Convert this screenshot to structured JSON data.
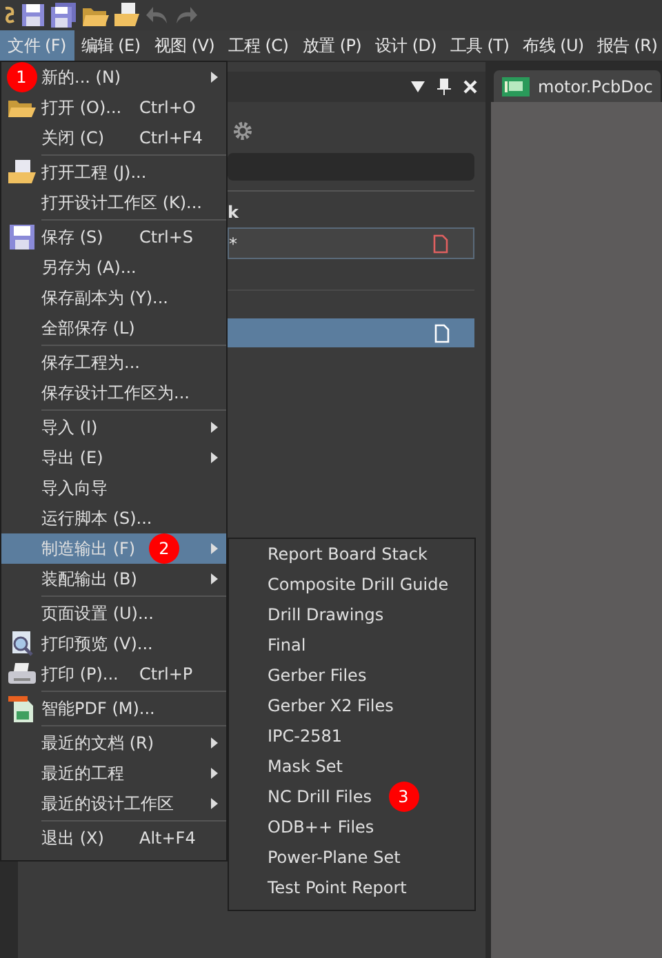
{
  "menubar": [
    {
      "label": "文件 (F)",
      "selected": true
    },
    {
      "label": "编辑 (E)",
      "selected": false
    },
    {
      "label": "视图 (V)",
      "selected": false
    },
    {
      "label": "工程 (C)",
      "selected": false
    },
    {
      "label": "放置 (P)",
      "selected": false
    },
    {
      "label": "设计 (D)",
      "selected": false
    },
    {
      "label": "工具 (T)",
      "selected": false
    },
    {
      "label": "布线 (U)",
      "selected": false
    },
    {
      "label": "报告 (R)",
      "selected": false
    }
  ],
  "document_tab": {
    "label": "motor.PcbDoc"
  },
  "panel": {
    "heading_fragment": "k",
    "row_fragment": "*"
  },
  "file_menu": [
    {
      "kind": "item",
      "label": "新的... (N)",
      "submenu": true,
      "selected": false,
      "badge": {
        "text": "1",
        "kind": "icon-slot"
      }
    },
    {
      "kind": "item",
      "label": "打开 (O)...",
      "shortcut": "Ctrl+O",
      "selected": false
    },
    {
      "kind": "item",
      "label": "关闭 (C)",
      "shortcut": "Ctrl+F4",
      "selected": false
    },
    {
      "kind": "separator"
    },
    {
      "kind": "item",
      "label": "打开工程 (J)...",
      "selected": false
    },
    {
      "kind": "item",
      "label": "打开设计工作区 (K)...",
      "selected": false
    },
    {
      "kind": "separator"
    },
    {
      "kind": "item",
      "label": "保存 (S)",
      "shortcut": "Ctrl+S",
      "selected": false
    },
    {
      "kind": "item",
      "label": "另存为 (A)...",
      "selected": false
    },
    {
      "kind": "item",
      "label": "保存副本为 (Y)...",
      "selected": false
    },
    {
      "kind": "item",
      "label": "全部保存 (L)",
      "selected": false
    },
    {
      "kind": "separator"
    },
    {
      "kind": "item",
      "label": "保存工程为...",
      "selected": false
    },
    {
      "kind": "item",
      "label": "保存设计工作区为...",
      "selected": false
    },
    {
      "kind": "separator"
    },
    {
      "kind": "item",
      "label": "导入 (I)",
      "submenu": true,
      "selected": false
    },
    {
      "kind": "item",
      "label": "导出 (E)",
      "submenu": true,
      "selected": false
    },
    {
      "kind": "item",
      "label": "导入向导",
      "selected": false
    },
    {
      "kind": "item",
      "label": "运行脚本 (S)...",
      "selected": false
    },
    {
      "kind": "item",
      "label": "制造输出 (F)",
      "submenu": true,
      "selected": true,
      "badge": {
        "text": "2",
        "kind": "inline"
      }
    },
    {
      "kind": "item",
      "label": "装配输出 (B)",
      "submenu": true,
      "selected": false
    },
    {
      "kind": "separator"
    },
    {
      "kind": "item",
      "label": "页面设置 (U)...",
      "selected": false
    },
    {
      "kind": "item",
      "label": "打印预览 (V)...",
      "selected": false
    },
    {
      "kind": "item",
      "label": "打印 (P)...",
      "shortcut": "Ctrl+P",
      "selected": false
    },
    {
      "kind": "separator"
    },
    {
      "kind": "item",
      "label": "智能PDF (M)...",
      "selected": false
    },
    {
      "kind": "separator"
    },
    {
      "kind": "item",
      "label": "最近的文档 (R)",
      "submenu": true,
      "selected": false
    },
    {
      "kind": "item",
      "label": "最近的工程",
      "submenu": true,
      "selected": false
    },
    {
      "kind": "item",
      "label": "最近的设计工作区",
      "submenu": true,
      "selected": false
    },
    {
      "kind": "separator"
    },
    {
      "kind": "item",
      "label": "退出 (X)",
      "shortcut": "Alt+F4",
      "selected": false
    }
  ],
  "fabrication_submenu": [
    {
      "label": "Report Board Stack"
    },
    {
      "label": "Composite Drill Guide"
    },
    {
      "label": "Drill Drawings"
    },
    {
      "label": "Final"
    },
    {
      "label": "Gerber Files"
    },
    {
      "label": "Gerber X2 Files"
    },
    {
      "label": "IPC-2581"
    },
    {
      "label": "Mask Set"
    },
    {
      "label": "NC Drill Files",
      "badge": {
        "text": "3",
        "kind": "inline"
      }
    },
    {
      "label": "ODB++ Files"
    },
    {
      "label": "Power-Plane Set"
    },
    {
      "label": "Test Point Report"
    }
  ]
}
